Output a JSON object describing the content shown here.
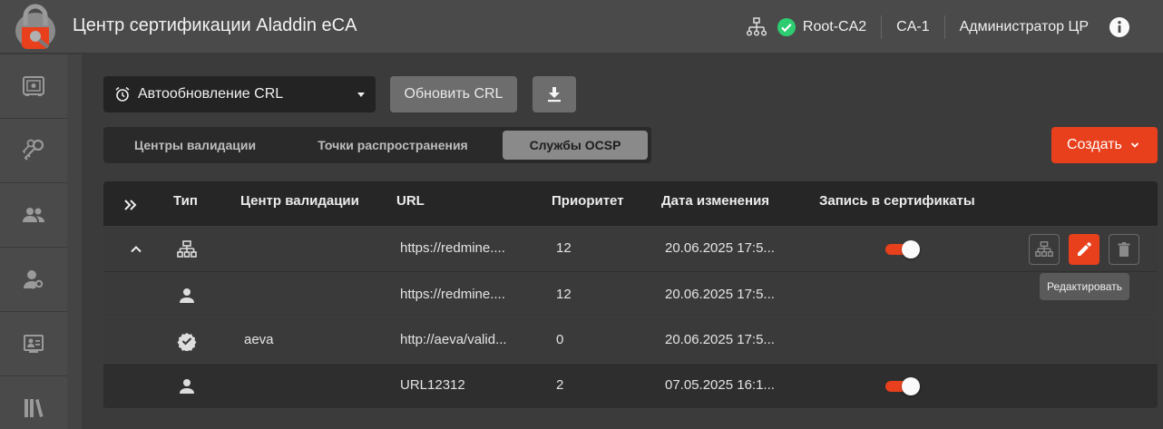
{
  "header": {
    "title": "Центр сертификации Aladdin eCA",
    "ca_name": "Root-CA2",
    "ca_node": "CA-1",
    "user_role": "Администратор ЦР",
    "icons": [
      "logo-icon",
      "hierarchy-icon",
      "status-ok-icon",
      "info-icon"
    ],
    "status_color": "#2ecc71"
  },
  "sidebar": {
    "items": [
      {
        "icon": "safe-icon"
      },
      {
        "icon": "keys-icon"
      },
      {
        "icon": "users-icon"
      },
      {
        "icon": "user-key-icon"
      },
      {
        "icon": "certificate-user-icon"
      },
      {
        "icon": "library-icon"
      }
    ]
  },
  "toolbar": {
    "auto_update_label": "Автообновление CRL",
    "refresh_label": "Обновить CRL",
    "download_icon": "download-icon"
  },
  "tabs": [
    {
      "label": "Центры валидации",
      "active": false
    },
    {
      "label": "Точки распространения",
      "active": false
    },
    {
      "label": "Службы OCSP",
      "active": true
    }
  ],
  "create_button": {
    "label": "Создать"
  },
  "table": {
    "columns": [
      "Тип",
      "Центр валидации",
      "URL",
      "Приоритет",
      "Дата изменения",
      "Запись в сертификаты"
    ],
    "rows": [
      {
        "type_icon": "hierarchy-icon",
        "center": "",
        "url": "https://redmine....",
        "priority": "12",
        "date": "20.06.2025 17:5...",
        "write_to_cert": true,
        "expanded": true
      },
      {
        "type_icon": "person-icon",
        "center": "",
        "url": "https://redmine....",
        "priority": "12",
        "date": "20.06.2025 17:5...",
        "write_to_cert": false
      },
      {
        "type_icon": "verified-icon",
        "center": "aeva",
        "url": "http://aeva/valid...",
        "priority": "0",
        "date": "20.06.2025 17:5...",
        "write_to_cert": false
      },
      {
        "type_icon": "person-icon",
        "center": "",
        "url": "URL12312",
        "priority": "2",
        "date": "07.05.2025 16:1...",
        "write_to_cert": true
      }
    ]
  },
  "tooltip": {
    "text": "Редактировать"
  },
  "colors": {
    "accent": "#e8401c",
    "header_bg": "#4a4a4a",
    "page_bg": "#3b3b3b"
  }
}
